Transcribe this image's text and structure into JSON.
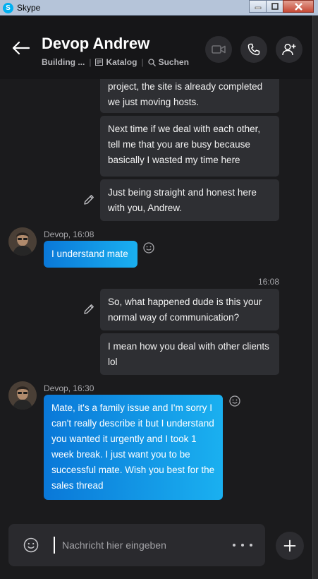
{
  "window": {
    "app_title": "Skype",
    "logo_letter": "S"
  },
  "header": {
    "contact_name": "Devop Andrew",
    "group_label": "Building ...",
    "separator": "|",
    "catalog_label": "Katalog",
    "search_label": "Suchen"
  },
  "messages": {
    "out1_text": "project, the site is already completed we just moving hosts.",
    "out2_text": "Next time if we deal with each other, tell me that you are busy because basically I wasted my time here",
    "out3_text": "Just being straight and honest here with you, Andrew.",
    "in1_sender": "Devop, 16:08",
    "in1_text": "I understand mate",
    "out_time": "16:08",
    "out4_text": "So, what happened dude is this your normal way of communication?",
    "out5_text": "I mean how you deal with other clients lol",
    "in2_sender": "Devop, 16:30",
    "in2_text": "Mate, it's a family issue and I'm sorry I can't really describe it but I understand you wanted it urgently and I took 1 week break. I just want you to be successful mate. Wish you best for the sales thread"
  },
  "composer": {
    "placeholder": "Nachricht hier eingeben",
    "value": ""
  },
  "colors": {
    "accent": "#00aff0",
    "bubble_gradient_start": "#0a78d8",
    "bubble_gradient_end": "#1ab0f0",
    "background": "#1b1b1d"
  },
  "icons": [
    "back-arrow-icon",
    "catalog-icon",
    "search-icon",
    "video-call-icon",
    "phone-icon",
    "add-person-icon",
    "edit-pencil-icon",
    "smiley-icon",
    "more-icon",
    "plus-icon"
  ]
}
